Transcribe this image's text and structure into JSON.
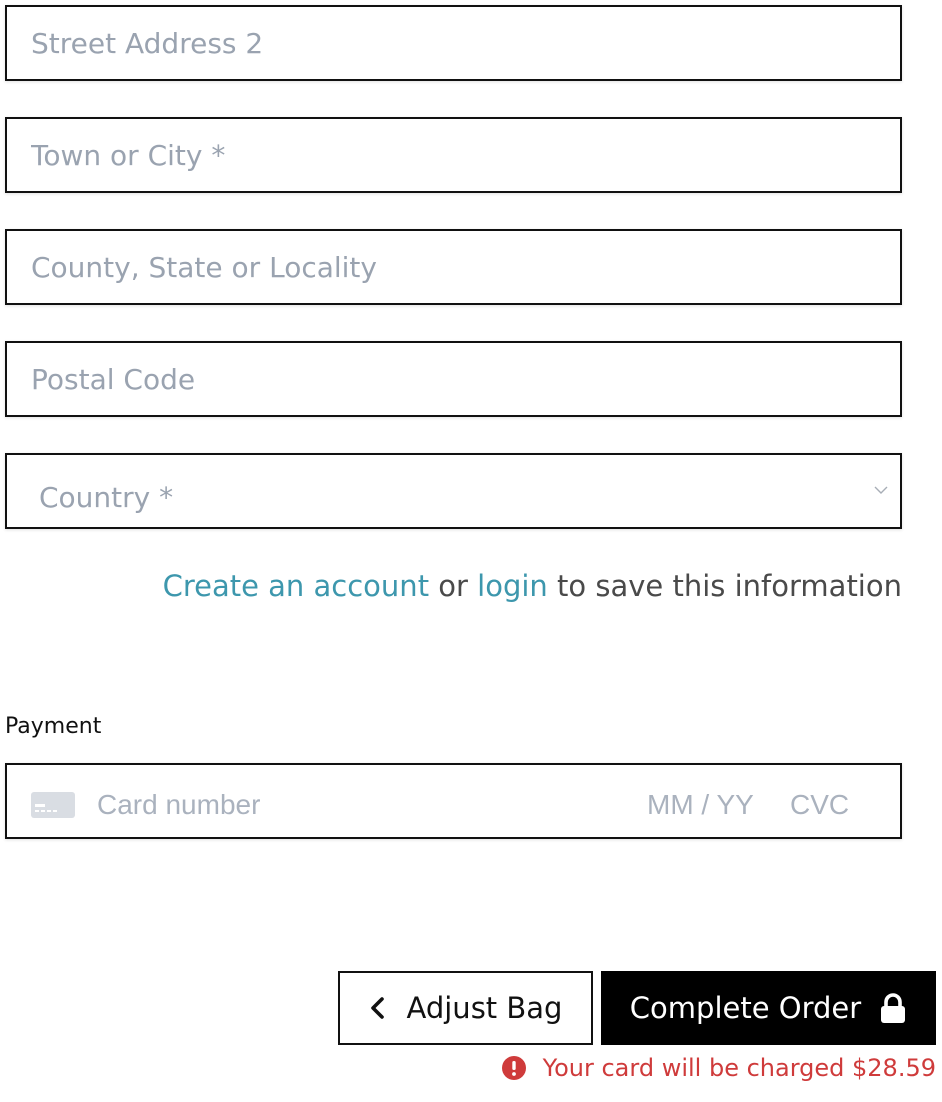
{
  "address_form": {
    "street_address_2": {
      "placeholder": "Street Address 2",
      "value": ""
    },
    "town_or_city": {
      "placeholder": "Town or City *",
      "value": ""
    },
    "county_state_locality": {
      "placeholder": "County, State or Locality",
      "value": ""
    },
    "postal_code": {
      "placeholder": "Postal Code",
      "value": ""
    },
    "country": {
      "placeholder": "Country *",
      "icon": "chevron-down-icon"
    }
  },
  "account_prompt": {
    "create_account_link": "Create an account",
    "or_text": "or",
    "login_link": "login",
    "suffix_text": "to save this information"
  },
  "payment": {
    "label": "Payment",
    "card_icon": "credit-card-icon",
    "card_number_placeholder": "Card number",
    "expiry_placeholder": "MM / YY",
    "cvc_placeholder": "CVC"
  },
  "actions": {
    "adjust_bag_label": "Adjust Bag",
    "adjust_bag_icon": "chevron-left-icon",
    "complete_order_label": "Complete Order",
    "complete_order_icon": "lock-icon"
  },
  "charge_notice": {
    "icon": "alert-circle-icon",
    "text": "Your card will be charged $28.59",
    "color": "#cf3b3b"
  },
  "colors": {
    "link": "#3d97ad",
    "border": "#111111",
    "placeholder": "#9aa3b0",
    "primary_button": "#000000"
  }
}
